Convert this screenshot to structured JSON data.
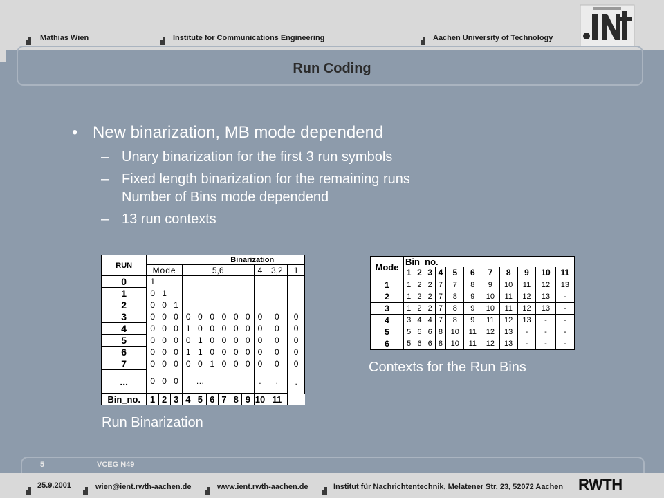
{
  "header": {
    "author": "Mathias Wien",
    "institute": "Institute for Communications Engineering",
    "university": "Aachen University of Technology"
  },
  "title": "Run Coding",
  "bullets": {
    "main": "New binarization, MB mode dependend",
    "sub1": "Unary binarization for the first 3 run symbols",
    "sub2a": "Fixed length binarization for the remaining runs",
    "sub2b": "Number of Bins mode dependend",
    "sub3": "13 run contexts"
  },
  "binarization_table": {
    "run_header": "RUN",
    "binarization_header": "Binarization",
    "mode_header": "Mode",
    "mode_groups": [
      "5,6",
      "4",
      "3,2",
      "1"
    ],
    "rows": [
      {
        "run": "0",
        "bins": [
          "1",
          "",
          "",
          "",
          "",
          "",
          "",
          "",
          "",
          "",
          "",
          ""
        ]
      },
      {
        "run": "1",
        "bins": [
          "0",
          "1",
          "",
          "",
          "",
          "",
          "",
          "",
          "",
          "",
          "",
          ""
        ]
      },
      {
        "run": "2",
        "bins": [
          "0",
          "0",
          "1",
          "",
          "",
          "",
          "",
          "",
          "",
          "",
          "",
          ""
        ]
      },
      {
        "run": "3",
        "bins": [
          "0",
          "0",
          "0",
          "0",
          "0",
          "0",
          "0",
          "0",
          "0",
          "0",
          "0",
          "0"
        ]
      },
      {
        "run": "4",
        "bins": [
          "0",
          "0",
          "0",
          "1",
          "0",
          "0",
          "0",
          "0",
          "0",
          "0",
          "0",
          "0"
        ]
      },
      {
        "run": "5",
        "bins": [
          "0",
          "0",
          "0",
          "0",
          "1",
          "0",
          "0",
          "0",
          "0",
          "0",
          "0",
          "0"
        ]
      },
      {
        "run": "6",
        "bins": [
          "0",
          "0",
          "0",
          "1",
          "1",
          "0",
          "0",
          "0",
          "0",
          "0",
          "0",
          "0"
        ]
      },
      {
        "run": "7",
        "bins": [
          "0",
          "0",
          "0",
          "0",
          "0",
          "1",
          "0",
          "0",
          "0",
          "0",
          "0",
          "0"
        ]
      },
      {
        "run": "...",
        "bins": [
          "0",
          "0",
          "0",
          "",
          "…",
          "",
          "",
          "",
          "",
          ".",
          ".",
          "."
        ]
      }
    ],
    "bin_no_label": "Bin_no.",
    "bin_numbers": [
      "1",
      "2",
      "3",
      "4",
      "5",
      "6",
      "7",
      "8",
      "9",
      "10",
      "11"
    ],
    "caption": "Run Binarization"
  },
  "contexts_table": {
    "mode_header": "Mode",
    "bin_no_label": "Bin_no.",
    "bin_numbers": [
      "1",
      "2",
      "3",
      "4",
      "5",
      "6",
      "7",
      "8",
      "9",
      "10",
      "11"
    ],
    "rows": [
      {
        "mode": "1",
        "values": [
          "1",
          "2",
          "2",
          "7",
          "7",
          "8",
          "9",
          "10",
          "11",
          "12",
          "13"
        ]
      },
      {
        "mode": "2",
        "values": [
          "1",
          "2",
          "2",
          "7",
          "8",
          "9",
          "10",
          "11",
          "12",
          "13",
          "-"
        ]
      },
      {
        "mode": "3",
        "values": [
          "1",
          "2",
          "2",
          "7",
          "8",
          "9",
          "10",
          "11",
          "12",
          "13",
          "-"
        ]
      },
      {
        "mode": "4",
        "values": [
          "3",
          "4",
          "4",
          "7",
          "8",
          "9",
          "11",
          "12",
          "13",
          "-",
          "-"
        ]
      },
      {
        "mode": "5",
        "values": [
          "5",
          "6",
          "6",
          "8",
          "10",
          "11",
          "12",
          "13",
          "-",
          "-",
          "-"
        ]
      },
      {
        "mode": "6",
        "values": [
          "5",
          "6",
          "6",
          "8",
          "10",
          "11",
          "12",
          "13",
          "-",
          "-",
          "-"
        ]
      }
    ],
    "caption": "Contexts for the Run Bins"
  },
  "footer": {
    "page_number": "5",
    "doc_id": "VCEG N49",
    "date": "25.9.2001",
    "email": "wien@ient.rwth-aachen.de",
    "website": "www.ient.rwth-aachen.de",
    "address": "Institut für Nachrichtentechnik, Melatener Str. 23, 52072 Aachen",
    "logo_text": "RWTH"
  },
  "colors": {
    "background": "#8d9bab",
    "band": "#d9d9d9",
    "text_light": "#ffffff"
  }
}
